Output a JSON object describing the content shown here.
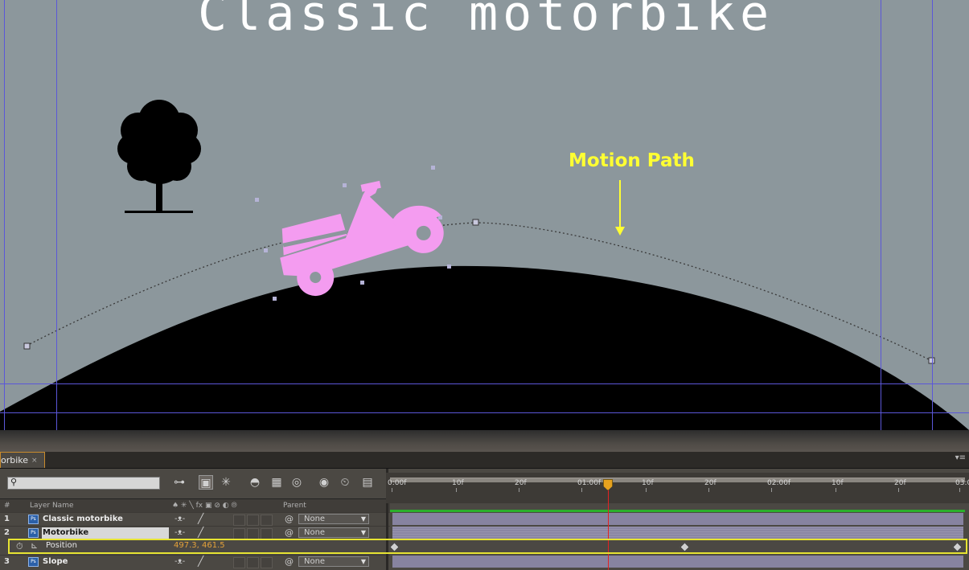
{
  "composition": {
    "title": "Classic motorbike",
    "annotation": "Motion Path",
    "colors": {
      "background": "#8c979c",
      "motorbike": "#f49cf0",
      "annotation": "#ffff33",
      "guides": "#5b57d8"
    }
  },
  "timeline_panel": {
    "tab_label": "orbike",
    "tab_close": "×",
    "panel_menu": "▾≡",
    "search_placeholder": "",
    "columns": {
      "num": "#",
      "layer_name": "Layer Name",
      "switches": "♠ ✳ ╲ fx ▣ ⊘ ◐ ⦾",
      "parent": "Parent"
    },
    "layers": [
      {
        "num": "1",
        "name": "Classic motorbike",
        "parent": "None"
      },
      {
        "num": "2",
        "name": "Motorbike",
        "parent": "None"
      },
      {
        "num": "3",
        "name": "Slope",
        "parent": "None"
      }
    ],
    "position_property": {
      "label": "Position",
      "value": "497.3, 461.5"
    },
    "ruler_ticks": [
      "0:00f",
      "10f",
      "20f",
      "01:00f",
      "10f",
      "20f",
      "02:00f",
      "10f",
      "20f",
      "03:0"
    ],
    "current_time_marker": "01:10f",
    "keyframes_count": 3
  }
}
